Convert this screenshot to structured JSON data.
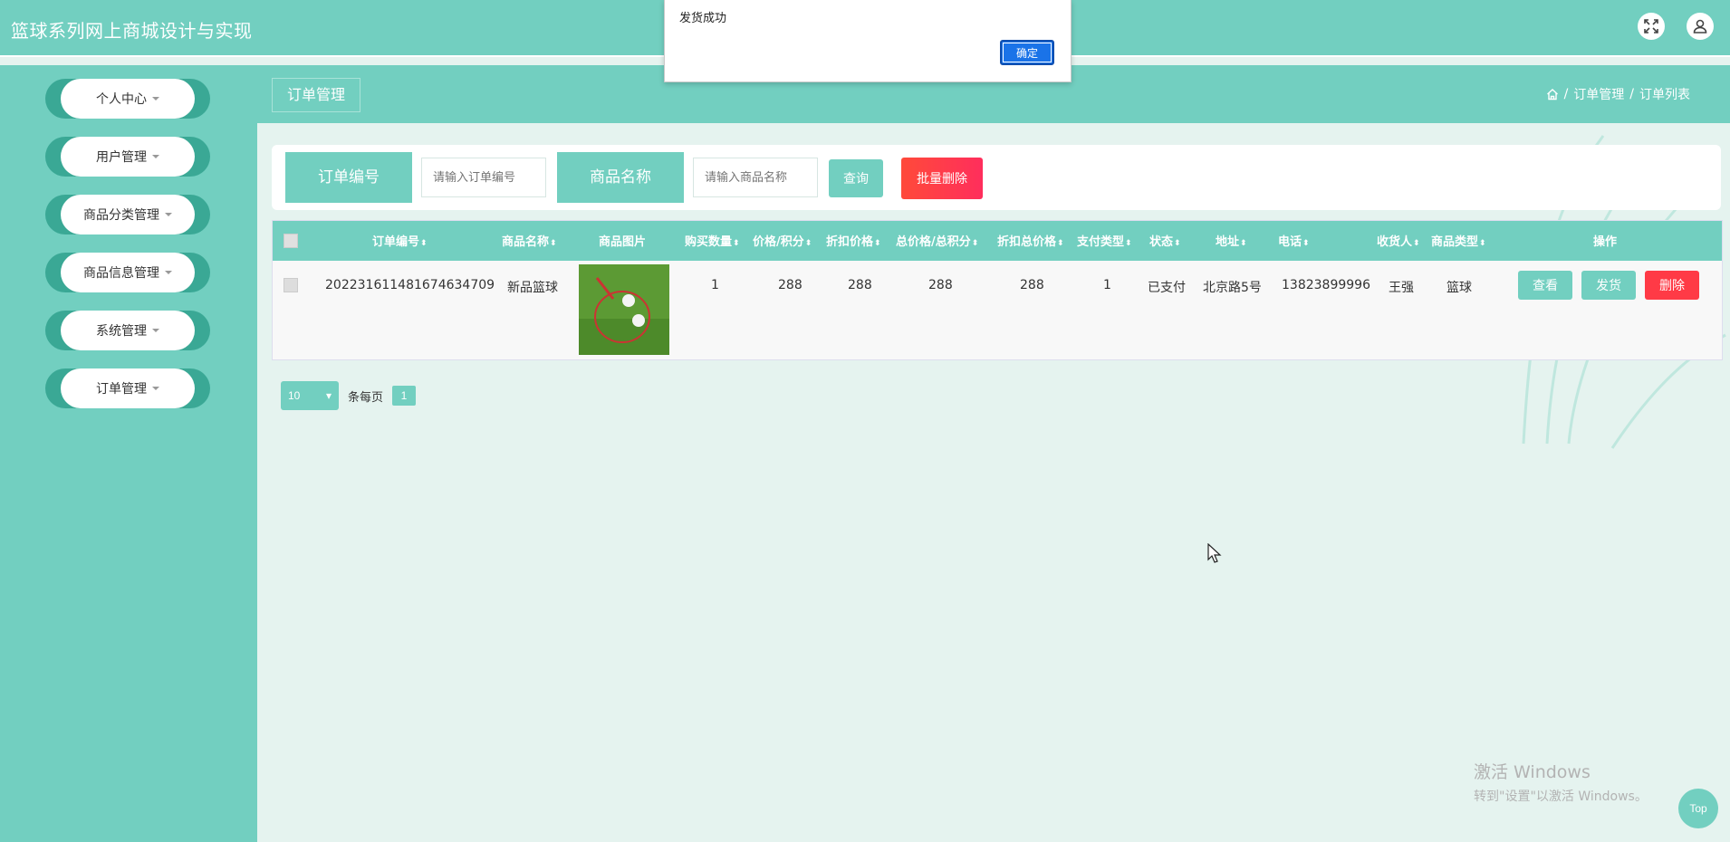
{
  "app": {
    "title": "篮球系列网上商城设计与实现"
  },
  "sidebar": {
    "items": [
      {
        "label": "个人中心"
      },
      {
        "label": "用户管理"
      },
      {
        "label": "商品分类管理"
      },
      {
        "label": "商品信息管理"
      },
      {
        "label": "系统管理"
      },
      {
        "label": "订单管理"
      }
    ]
  },
  "page": {
    "title": "订单管理",
    "breadcrumb": {
      "sep": "/",
      "level1": "订单管理",
      "level2": "订单列表"
    }
  },
  "search": {
    "order_label": "订单编号",
    "order_placeholder": "请输入订单编号",
    "product_label": "商品名称",
    "product_placeholder": "请输入商品名称",
    "query_button": "查询",
    "batch_delete_button": "批量删除"
  },
  "table": {
    "columns": [
      "订单编号",
      "商品名称",
      "商品图片",
      "购买数量",
      "价格/积分",
      "折扣价格",
      "总价格/总积分",
      "折扣总价格",
      "支付类型",
      "状态",
      "地址",
      "电话",
      "收货人",
      "商品类型",
      "操作"
    ],
    "rows": [
      {
        "order_no": "202231611481674634709",
        "product_name": "新品篮球",
        "quantity": "1",
        "price": "288",
        "discount_price": "288",
        "total_price": "288",
        "discount_total": "288",
        "pay_type": "1",
        "status": "已支付",
        "address": "北京路5号",
        "phone": "13823899996",
        "receiver": "王强",
        "product_type": "篮球"
      }
    ],
    "actions": {
      "view": "查看",
      "ship": "发货",
      "delete": "删除"
    }
  },
  "pager": {
    "page_size": "10",
    "per_page_label": "条每页",
    "current_page": "1"
  },
  "dialog": {
    "message": "发货成功",
    "ok": "确定"
  },
  "watermark": {
    "line1": "激活 Windows",
    "line2": "转到\"设置\"以激活 Windows。"
  },
  "back_to_top": "Top",
  "colors": {
    "primary": "#72cfc0",
    "danger": "#ff3a46",
    "dialog_button": "#1a73e8"
  }
}
